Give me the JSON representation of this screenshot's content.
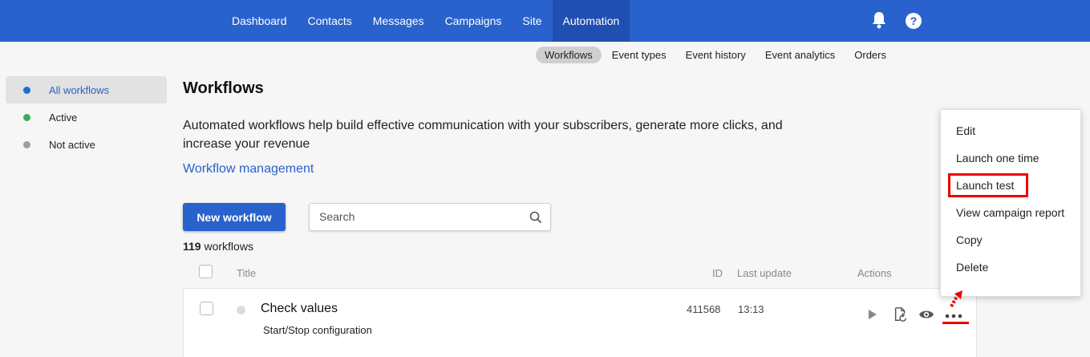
{
  "topnav": {
    "items": [
      "Dashboard",
      "Contacts",
      "Messages",
      "Campaigns",
      "Site",
      "Automation"
    ],
    "active": "Automation",
    "help_label": "?"
  },
  "subnav": {
    "items": [
      "Workflows",
      "Event types",
      "Event history",
      "Event analytics",
      "Orders"
    ]
  },
  "sidebar": {
    "items": [
      {
        "label": "All workflows",
        "color": "#1a6fcf"
      },
      {
        "label": "Active",
        "color": "#3cab5a"
      },
      {
        "label": "Not active",
        "color": "#9e9e9e"
      }
    ]
  },
  "main": {
    "title": "Workflows",
    "description": "Automated workflows help build effective communication with your subscribers, generate more clicks, and increase your revenue",
    "link": "Workflow management",
    "new_button": "New workflow",
    "search_placeholder": "Search",
    "count_number": "119",
    "count_label": "workflows"
  },
  "table": {
    "headers": {
      "title": "Title",
      "id": "ID",
      "last_update": "Last update",
      "actions": "Actions"
    },
    "rows": [
      {
        "title": "Check values",
        "subtitle": "Start/Stop configuration",
        "id": "411568",
        "last_update": "13:13"
      }
    ]
  },
  "context_menu": {
    "items": [
      "Edit",
      "Launch one time",
      "Launch test",
      "View campaign report",
      "Copy",
      "Delete"
    ],
    "highlighted": "Launch test"
  },
  "colors": {
    "primary": "#2962cc",
    "annotation": "#e00000"
  }
}
